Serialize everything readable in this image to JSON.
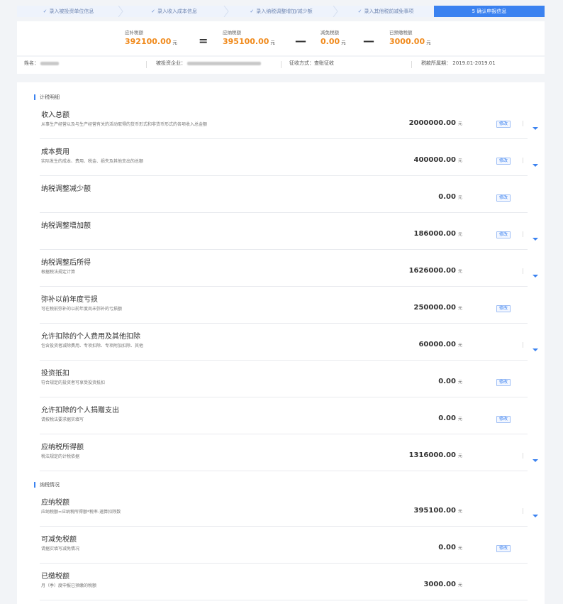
{
  "steps": [
    {
      "label": "录入被投资单位信息",
      "done": true
    },
    {
      "label": "录入收入成本信息",
      "done": true
    },
    {
      "label": "录入纳税调整增加/减少额",
      "done": true
    },
    {
      "label": "录入其他税前减免事项",
      "done": true
    },
    {
      "label": "5 确认申报信息",
      "done": false,
      "active": true
    }
  ],
  "summary": {
    "items": [
      {
        "label": "应补税额",
        "value": "392100.00",
        "unit": "元"
      },
      {
        "label": "应纳税额",
        "value": "395100.00",
        "unit": "元"
      },
      {
        "label": "减免税额",
        "value": "0.00",
        "unit": "元"
      },
      {
        "label": "已预缴税额",
        "value": "3000.00",
        "unit": "元"
      }
    ],
    "operators": [
      "=",
      "—",
      "—"
    ]
  },
  "info": {
    "name_label": "姓名：",
    "company_label": "被投资企业：",
    "method_label": "征收方式：",
    "method_value": "查账征收",
    "period_label": "税款所属期：",
    "period_value": "2019.01-2019.01"
  },
  "sections": [
    {
      "title": "计税明细"
    },
    {
      "title": "纳税情况"
    }
  ],
  "rows": [
    {
      "title": "收入总额",
      "desc": "从事生产经营以及与生产经营有关的活动取得的货币形式和非货币形式的各项收入总金额",
      "value": "2000000.00",
      "unit": "元",
      "edit": "修改",
      "expand": true
    },
    {
      "title": "成本费用",
      "desc": "实际发生的成本、费用、税金、损失及其他支出的总额",
      "value": "400000.00",
      "unit": "元",
      "edit": "修改",
      "expand": true
    },
    {
      "title": "纳税调整减少额",
      "desc": "",
      "value": "0.00",
      "unit": "元",
      "edit": "修改",
      "expand": false
    },
    {
      "title": "纳税调整增加额",
      "desc": "",
      "value": "186000.00",
      "unit": "元",
      "edit": "修改",
      "expand": true
    },
    {
      "title": "纳税调整后所得",
      "desc": "根据税法规定计算",
      "value": "1626000.00",
      "unit": "元",
      "edit": "",
      "expand": true
    },
    {
      "title": "弥补以前年度亏损",
      "desc": "可在税前弥补的以前年度尚未弥补的亏损额",
      "value": "250000.00",
      "unit": "元",
      "edit": "修改",
      "expand": false
    },
    {
      "title": "允许扣除的个人费用及其他扣除",
      "desc": "包含投资者减除费用、专项扣除、专项附加扣除、其他",
      "value": "60000.00",
      "unit": "元",
      "edit": "",
      "expand": true
    },
    {
      "title": "投资抵扣",
      "desc": "符合规定的投资者可享受投资抵扣",
      "value": "0.00",
      "unit": "元",
      "edit": "修改",
      "expand": false
    },
    {
      "title": "允许扣除的个人捐赠支出",
      "desc": "请按税法要求据实填写",
      "value": "0.00",
      "unit": "元",
      "edit": "修改",
      "expand": false
    },
    {
      "title": "应纳税所得额",
      "desc": "税法规定的计税依据",
      "value": "1316000.00",
      "unit": "元",
      "edit": "",
      "expand": true
    },
    {
      "title": "应纳税额",
      "desc": "应纳税额=应纳税所得额*税率-速算扣除数",
      "value": "395100.00",
      "unit": "元",
      "edit": "",
      "expand": true
    },
    {
      "title": "可减免税额",
      "desc": "请据实填写减免情况",
      "value": "0.00",
      "unit": "元",
      "edit": "修改",
      "expand": false
    },
    {
      "title": "已缴税额",
      "desc": "月（季）度申报已预缴的税额",
      "value": "3000.00",
      "unit": "元",
      "edit": "",
      "expand": false
    }
  ],
  "colors": {
    "accent": "#3b82f0",
    "amount": "#f08a1c"
  }
}
